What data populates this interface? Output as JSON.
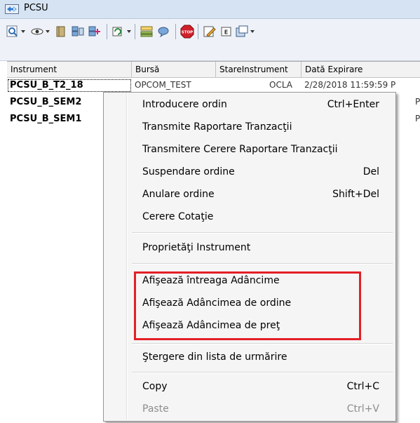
{
  "window": {
    "title": "PCSU"
  },
  "toolbar": {
    "icons": [
      "search-icon",
      "eye-icon",
      "book-icon",
      "stack-icon",
      "stack-add-icon",
      "refresh-icon",
      "layout-icon",
      "chat-icon",
      "stop-icon",
      "edit-icon",
      "e-icon",
      "export-icon"
    ],
    "stop_label": "STOP",
    "e_label": "E"
  },
  "grid": {
    "columns": [
      "Instrument",
      "Bursă",
      "StareInstrument",
      "Dată Expirare"
    ],
    "rows": [
      {
        "instrument": "PCSU_B_T2_18",
        "bursa": "OPCOM_TEST",
        "stare": "OCLA",
        "expirare": "2/28/2018 11:59:59 P"
      },
      {
        "instrument": "PCSU_B_SEM2",
        "bursa": "",
        "stare": "",
        "expirare": "P"
      },
      {
        "instrument": "PCSU_B_SEM1",
        "bursa": "",
        "stare": "",
        "expirare": "P"
      }
    ]
  },
  "context_menu": {
    "items": [
      {
        "label": "Introducere ordin",
        "shortcut": "Ctrl+Enter"
      },
      {
        "label": "Transmite Raportare Tranzacţii",
        "shortcut": ""
      },
      {
        "label": "Transmitere Cerere Raportare Tranzacţii",
        "shortcut": ""
      },
      {
        "label": "Suspendare ordine",
        "shortcut": "Del"
      },
      {
        "label": "Anulare ordine",
        "shortcut": "Shift+Del"
      },
      {
        "label": "Cerere Cotaţie",
        "shortcut": ""
      },
      {
        "label": "Proprietăţi Instrument",
        "shortcut": ""
      },
      {
        "label": "Afişează întreaga Adâncime",
        "shortcut": ""
      },
      {
        "label": "Afişează Adâncimea de ordine",
        "shortcut": ""
      },
      {
        "label": "Afişează Adâncimea de preţ",
        "shortcut": ""
      },
      {
        "label": "Ştergere din lista de urmărire",
        "shortcut": ""
      },
      {
        "label": "Copy",
        "shortcut": "Ctrl+C"
      },
      {
        "label": "Paste",
        "shortcut": "Ctrl+V",
        "disabled": true
      }
    ]
  },
  "colors": {
    "highlight_border": "#e41f26",
    "titlebar": "#d6e3f2",
    "menu_bg": "#f5f5f5"
  }
}
